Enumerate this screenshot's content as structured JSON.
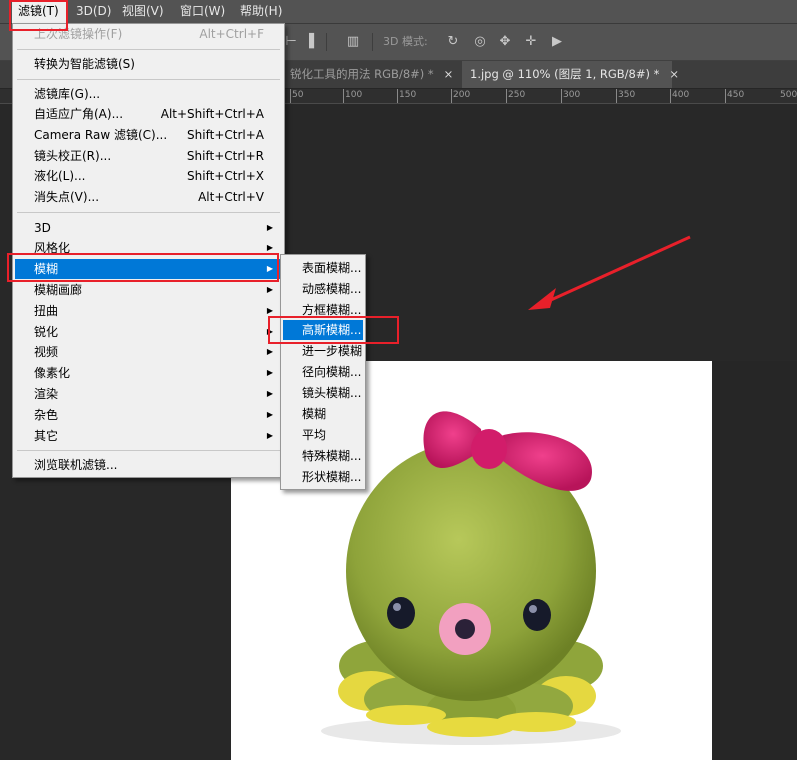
{
  "menubar": {
    "items": [
      {
        "label": "滤镜(T)"
      },
      {
        "label": "3D(D)"
      },
      {
        "label": "视图(V)"
      },
      {
        "label": "窗口(W)"
      },
      {
        "label": "帮助(H)"
      }
    ]
  },
  "optionsbar": {
    "mode_label": "3D 模式:"
  },
  "tabs": [
    {
      "label": "锐化工具的用法 RGB/8#) *",
      "close": "×"
    },
    {
      "label": "1.jpg @ 110% (图层 1, RGB/8#) *",
      "close": "×"
    }
  ],
  "ruler": {
    "labels": [
      "50",
      "100",
      "150",
      "200",
      "250",
      "300",
      "350",
      "400",
      "450",
      "500"
    ]
  },
  "filter_menu": {
    "items": [
      {
        "label": "上次滤镜操作(F)",
        "shortcut": "Alt+Ctrl+F"
      },
      {
        "label": "转换为智能滤镜(S)",
        "shortcut": ""
      },
      {
        "label": "滤镜库(G)...",
        "shortcut": ""
      },
      {
        "label": "自适应广角(A)...",
        "shortcut": "Alt+Shift+Ctrl+A"
      },
      {
        "label": "Camera Raw 滤镜(C)...",
        "shortcut": "Shift+Ctrl+A"
      },
      {
        "label": "镜头校正(R)...",
        "shortcut": "Shift+Ctrl+R"
      },
      {
        "label": "液化(L)...",
        "shortcut": "Shift+Ctrl+X"
      },
      {
        "label": "消失点(V)...",
        "shortcut": "Alt+Ctrl+V"
      },
      {
        "label": "3D"
      },
      {
        "label": "风格化"
      },
      {
        "label": "模糊"
      },
      {
        "label": "模糊画廊"
      },
      {
        "label": "扭曲"
      },
      {
        "label": "锐化"
      },
      {
        "label": "视频"
      },
      {
        "label": "像素化"
      },
      {
        "label": "渲染"
      },
      {
        "label": "杂色"
      },
      {
        "label": "其它"
      },
      {
        "label": "浏览联机滤镜..."
      }
    ],
    "submenu_arrow": "▶"
  },
  "blur_submenu": {
    "items": [
      {
        "label": "表面模糊..."
      },
      {
        "label": "动感模糊..."
      },
      {
        "label": "方框模糊..."
      },
      {
        "label": "高斯模糊..."
      },
      {
        "label": "进一步模糊"
      },
      {
        "label": "径向模糊..."
      },
      {
        "label": "镜头模糊..."
      },
      {
        "label": "模糊"
      },
      {
        "label": "平均"
      },
      {
        "label": "特殊模糊..."
      },
      {
        "label": "形状模糊..."
      }
    ]
  },
  "colors": {
    "highlight": "#0078d7",
    "annotation_red": "#e8202a"
  }
}
